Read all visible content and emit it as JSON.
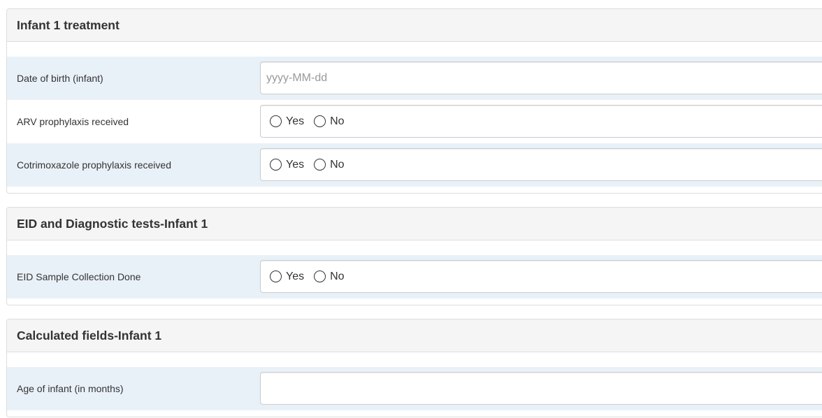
{
  "sections": [
    {
      "title": "Infant 1 treatment",
      "rows": [
        {
          "label": "Date of birth (infant)",
          "type": "text",
          "value": "",
          "placeholder": "yyyy-MM-dd"
        },
        {
          "label": "ARV prophylaxis received",
          "type": "radio",
          "options": [
            "Yes",
            "No"
          ]
        },
        {
          "label": "Cotrimoxazole prophylaxis received",
          "type": "radio",
          "options": [
            "Yes",
            "No"
          ]
        }
      ]
    },
    {
      "title": "EID and Diagnostic tests-Infant 1",
      "rows": [
        {
          "label": "EID Sample Collection Done",
          "type": "radio",
          "options": [
            "Yes",
            "No"
          ]
        }
      ]
    },
    {
      "title": "Calculated fields-Infant 1",
      "rows": [
        {
          "label": "Age of infant (in months)",
          "type": "text",
          "value": "",
          "placeholder": ""
        }
      ]
    }
  ],
  "colors": {
    "heading_bg": "#f5f5f5",
    "row_shade": "#e9f1f8",
    "border": "#dddddd",
    "text": "#333333",
    "placeholder": "#999999"
  }
}
